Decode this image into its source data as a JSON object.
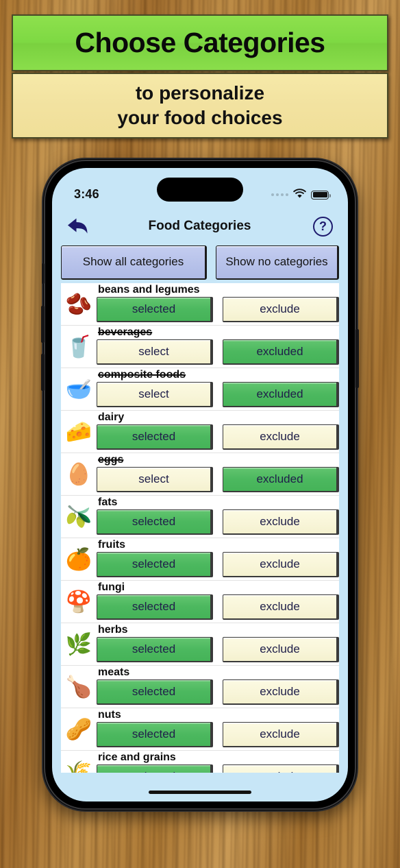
{
  "promo": {
    "title": "Choose Categories",
    "subtitle_line1": "to personalize",
    "subtitle_line2": "your food choices"
  },
  "status_bar": {
    "time": "3:46",
    "cellular_icon": "cellular-dots-icon",
    "wifi_icon": "wifi-icon",
    "battery_icon": "battery-full-icon"
  },
  "nav": {
    "back_icon": "back-arrow-icon",
    "title": "Food Categories",
    "help_label": "?"
  },
  "toolbar": {
    "show_all_label": "Show all categories",
    "show_none_label": "Show no categories"
  },
  "colors": {
    "selected_green": "#4cb85f",
    "unselected_cream": "#f8f5d8",
    "toolbar_blue": "#b7c2ea",
    "screen_bg": "#c7e6f7",
    "banner_green": "#7ed943",
    "banner_yellow": "#f2e2a0",
    "nav_accent": "#1e1b6e"
  },
  "labels": {
    "selected": "selected",
    "select": "select",
    "exclude": "exclude",
    "excluded": "excluded"
  },
  "categories": [
    {
      "name": "beans and legumes",
      "icon": "beans-icon",
      "glyph": "🫘",
      "state": "selected",
      "left_label": "selected",
      "right_label": "exclude",
      "struck": false
    },
    {
      "name": "beverages",
      "icon": "beverage-icon",
      "glyph": "🥤",
      "state": "excluded",
      "left_label": "select",
      "right_label": "excluded",
      "struck": true
    },
    {
      "name": "composite foods",
      "icon": "bowl-icon",
      "glyph": "🥣",
      "state": "excluded",
      "left_label": "select",
      "right_label": "excluded",
      "struck": true
    },
    {
      "name": "dairy",
      "icon": "cheese-icon",
      "glyph": "🧀",
      "state": "selected",
      "left_label": "selected",
      "right_label": "exclude",
      "struck": false
    },
    {
      "name": "eggs",
      "icon": "egg-icon",
      "glyph": "🥚",
      "state": "excluded",
      "left_label": "select",
      "right_label": "excluded",
      "struck": true
    },
    {
      "name": "fats",
      "icon": "oil-bottle-icon",
      "glyph": "🫒",
      "state": "selected",
      "left_label": "selected",
      "right_label": "exclude",
      "struck": false
    },
    {
      "name": "fruits",
      "icon": "orange-icon",
      "glyph": "🍊",
      "state": "selected",
      "left_label": "selected",
      "right_label": "exclude",
      "struck": false
    },
    {
      "name": "fungi",
      "icon": "mushroom-icon",
      "glyph": "🍄",
      "state": "selected",
      "left_label": "selected",
      "right_label": "exclude",
      "struck": false
    },
    {
      "name": "herbs",
      "icon": "herb-leaf-icon",
      "glyph": "🌿",
      "state": "selected",
      "left_label": "selected",
      "right_label": "exclude",
      "struck": false
    },
    {
      "name": "meats",
      "icon": "poultry-icon",
      "glyph": "🍗",
      "state": "selected",
      "left_label": "selected",
      "right_label": "exclude",
      "struck": false
    },
    {
      "name": "nuts",
      "icon": "nuts-icon",
      "glyph": "🥜",
      "state": "selected",
      "left_label": "selected",
      "right_label": "exclude",
      "struck": false
    },
    {
      "name": "rice and grains",
      "icon": "wheat-icon",
      "glyph": "🌾",
      "state": "selected",
      "left_label": "selected",
      "right_label": "exclude",
      "struck": false
    }
  ]
}
